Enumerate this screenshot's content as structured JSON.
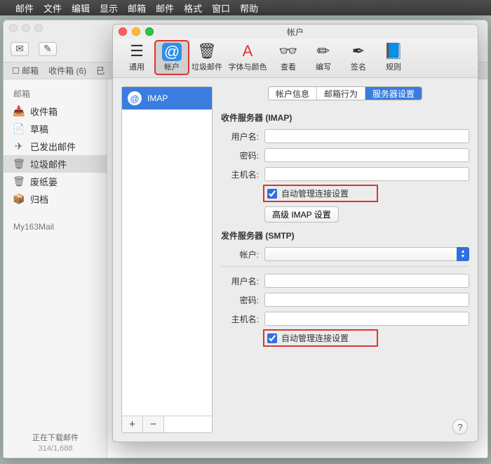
{
  "menubar": {
    "items": [
      "邮件",
      "文件",
      "编辑",
      "显示",
      "邮箱",
      "邮件",
      "格式",
      "窗口",
      "帮助"
    ]
  },
  "mailWindow": {
    "tabs": {
      "mailboxes": "邮箱",
      "inbox": "收件箱 (6)",
      "sent": "已"
    },
    "sidebar": {
      "heading": "邮箱",
      "items": [
        {
          "label": "收件箱"
        },
        {
          "label": "草稿"
        },
        {
          "label": "已发出邮件"
        },
        {
          "label": "垃圾邮件"
        },
        {
          "label": "废纸篓"
        },
        {
          "label": "归档"
        }
      ],
      "account": "My163Mail"
    },
    "status": {
      "line1": "正在下载邮件",
      "line2": "314/1,688"
    }
  },
  "prefs": {
    "title": "帐户",
    "toolbar": [
      {
        "label": "通用"
      },
      {
        "label": "帐户"
      },
      {
        "label": "垃圾邮件"
      },
      {
        "label": "字体与颜色"
      },
      {
        "label": "查看"
      },
      {
        "label": "编写"
      },
      {
        "label": "签名"
      },
      {
        "label": "规则"
      }
    ],
    "accountList": {
      "selected": "IMAP"
    },
    "tabs": {
      "info": "帐户信息",
      "behavior": "邮箱行为",
      "server": "服务器设置"
    },
    "form": {
      "incoming_header": "收件服务器 (IMAP)",
      "outgoing_header": "发件服务器 (SMTP)",
      "labels": {
        "user": "用户名:",
        "pass": "密码:",
        "host": "主机名:",
        "account": "帐户:"
      },
      "values": {
        "in_user": "",
        "in_pass": "",
        "in_host": "",
        "out_account": "",
        "out_user": "",
        "out_pass": "",
        "out_host": ""
      },
      "checkbox": "自动管理连接设置",
      "adv_button": "高级 IMAP 设置"
    }
  }
}
